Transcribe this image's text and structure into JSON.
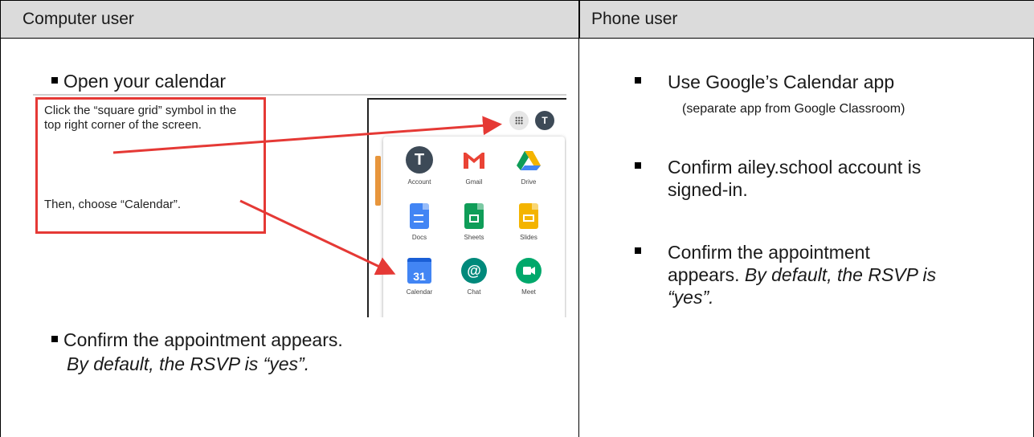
{
  "headers": {
    "left": "Computer user",
    "right": "Phone user"
  },
  "left": {
    "bullet1": "Open your calendar",
    "bullet2": "Confirm the appointment appears.",
    "bullet2_italic": "By default, the RSVP is “yes”."
  },
  "screenshot": {
    "instruction1": "Click the “square grid” symbol in the top right corner of the screen.",
    "instruction2": "Then, choose “Calendar”.",
    "account_initial": "T",
    "apps": [
      {
        "label": "Account",
        "icon": "account-icon",
        "glyph": "T"
      },
      {
        "label": "Gmail",
        "icon": "gmail-icon",
        "glyph": "M"
      },
      {
        "label": "Drive",
        "icon": "drive-icon"
      },
      {
        "label": "Docs",
        "icon": "docs-icon"
      },
      {
        "label": "Sheets",
        "icon": "sheets-icon"
      },
      {
        "label": "Slides",
        "icon": "slides-icon"
      },
      {
        "label": "Calendar",
        "icon": "calendar-icon",
        "glyph": "31"
      },
      {
        "label": "Chat",
        "icon": "chat-icon",
        "glyph": "@"
      },
      {
        "label": "Meet",
        "icon": "meet-icon"
      }
    ],
    "colors": {
      "highlight": "#e53935",
      "docs": "#4285f4",
      "sheets": "#0f9d58",
      "slides": "#f4b400",
      "gmail": "#ea4335"
    }
  },
  "right": {
    "item1": "Use Google’s Calendar app",
    "item1_sub": "(separate app from Google Classroom)",
    "item2_line1": "Confirm ailey.school account is",
    "item2_line2": "signed-in.",
    "item3_line1": "Confirm the appointment",
    "item3_line2_plain": "appears. ",
    "item3_line2_italic": "By default, the RSVP is",
    "item3_line3_italic": "“yes”."
  }
}
